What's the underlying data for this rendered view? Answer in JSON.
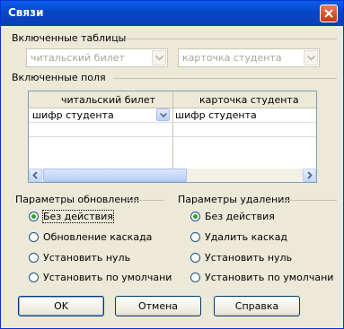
{
  "window": {
    "title": "Связи"
  },
  "tables_group": {
    "label": "Включенные таблицы",
    "left_table": "читальский билет",
    "right_table": "карточка студента"
  },
  "fields_group": {
    "label": "Включенные поля",
    "columns": [
      "читальский билет",
      "карточка студента"
    ],
    "rows": [
      {
        "left": "шифр студента",
        "right": "шифр студента"
      }
    ]
  },
  "update_group": {
    "label": "Параметры обновления",
    "options": [
      "Без действия",
      "Обновление каскада",
      "Установить нуль",
      "Установить по умолчани"
    ],
    "selected": 0
  },
  "delete_group": {
    "label": "Параметры удаления",
    "options": [
      "Без действия",
      "Удалить каскад",
      "Установить нуль",
      "Установить по умолчани"
    ],
    "selected": 0
  },
  "buttons": {
    "ok": "OK",
    "cancel": "Отмена",
    "help": "Справка"
  }
}
